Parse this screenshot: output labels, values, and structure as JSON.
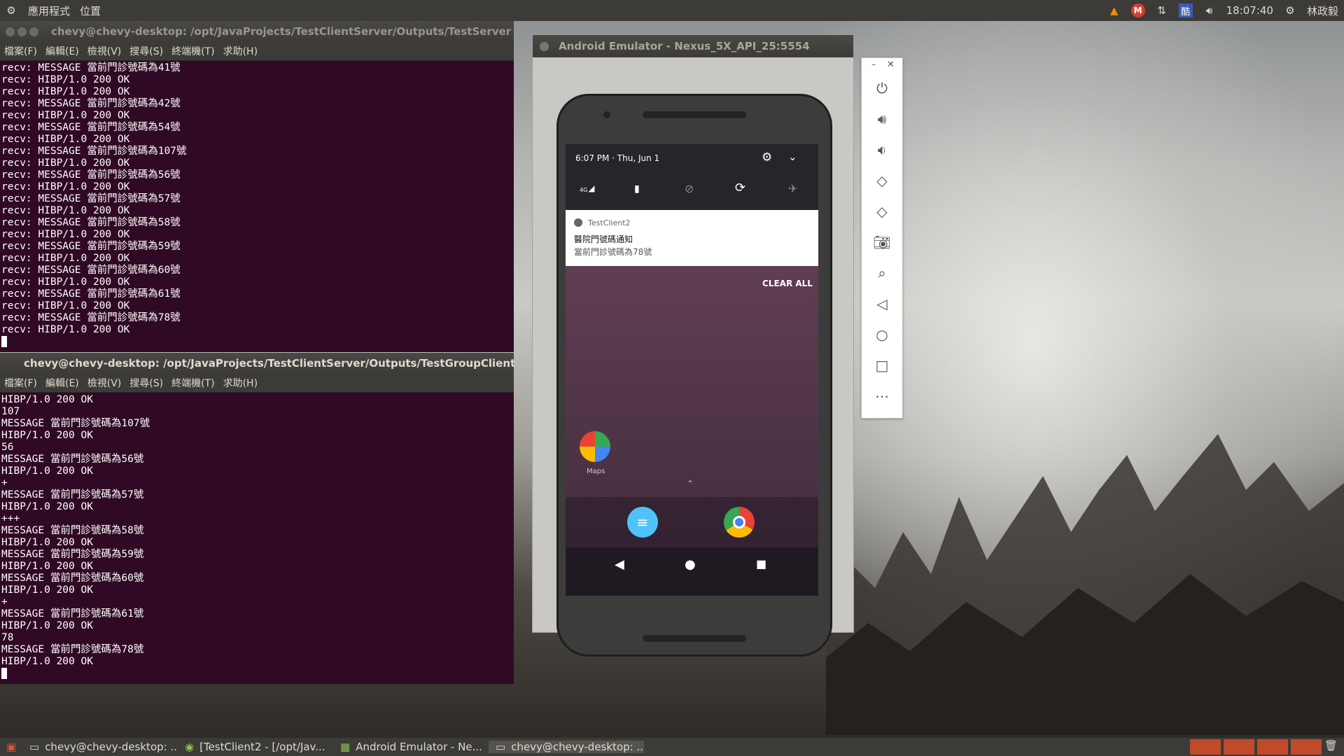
{
  "topbar": {
    "apps_menu": "應用程式",
    "places_menu": "位置",
    "clock": "18:07:40",
    "user": "林政毅",
    "ime_label": "酷"
  },
  "server_term": {
    "title": "chevy@chevy-desktop: /opt/JavaProjects/TestClientServer/Outputs/TestServer",
    "menu": [
      "檔案(F)",
      "編輯(E)",
      "檢視(V)",
      "搜尋(S)",
      "終端機(T)",
      "求助(H)"
    ],
    "lines": [
      "recv: MESSAGE 當前門診號碼為41號",
      "recv: HIBP/1.0 200 OK",
      "recv: HIBP/1.0 200 OK",
      "recv: MESSAGE 當前門診號碼為42號",
      "recv: HIBP/1.0 200 OK",
      "recv: MESSAGE 當前門診號碼為54號",
      "recv: HIBP/1.0 200 OK",
      "recv: MESSAGE 當前門診號碼為107號",
      "recv: HIBP/1.0 200 OK",
      "recv: MESSAGE 當前門診號碼為56號",
      "recv: HIBP/1.0 200 OK",
      "recv: MESSAGE 當前門診號碼為57號",
      "recv: HIBP/1.0 200 OK",
      "recv: MESSAGE 當前門診號碼為58號",
      "recv: HIBP/1.0 200 OK",
      "recv: MESSAGE 當前門診號碼為59號",
      "recv: HIBP/1.0 200 OK",
      "recv: MESSAGE 當前門診號碼為60號",
      "recv: HIBP/1.0 200 OK",
      "recv: MESSAGE 當前門診號碼為61號",
      "recv: HIBP/1.0 200 OK",
      "recv: MESSAGE 當前門診號碼為78號",
      "recv: HIBP/1.0 200 OK"
    ]
  },
  "client_term": {
    "title": "chevy@chevy-desktop: /opt/JavaProjects/TestClientServer/Outputs/TestGroupClient",
    "menu": [
      "檔案(F)",
      "編輯(E)",
      "檢視(V)",
      "搜尋(S)",
      "終端機(T)",
      "求助(H)"
    ],
    "lines": [
      "HIBP/1.0 200 OK",
      "107",
      "MESSAGE 當前門診號碼為107號",
      "HIBP/1.0 200 OK",
      "56",
      "MESSAGE 當前門診號碼為56號",
      "HIBP/1.0 200 OK",
      "+",
      "MESSAGE 當前門診號碼為57號",
      "HIBP/1.0 200 OK",
      "+++",
      "MESSAGE 當前門診號碼為58號",
      "HIBP/1.0 200 OK",
      "MESSAGE 當前門診號碼為59號",
      "HIBP/1.0 200 OK",
      "MESSAGE 當前門診號碼為60號",
      "HIBP/1.0 200 OK",
      "+",
      "MESSAGE 當前門診號碼為61號",
      "HIBP/1.0 200 OK",
      "78",
      "MESSAGE 當前門診號碼為78號",
      "HIBP/1.0 200 OK"
    ]
  },
  "emulator": {
    "title": "Android Emulator - Nexus_5X_API_25:5554",
    "status_time": "6:07 PM · Thu, Jun 1",
    "network_label": "4G",
    "notification": {
      "app": "TestClient2",
      "title": "醫院門號碼通知",
      "text": "當前門診號碼為78號"
    },
    "clear_all": "CLEAR ALL",
    "maps_label": "Maps"
  },
  "taskbar": {
    "tasks": [
      {
        "label": "chevy@chevy-desktop: ...",
        "icon": "terminal-icon"
      },
      {
        "label": "[TestClient2 - [/opt/Jav...",
        "icon": "android-studio-icon"
      },
      {
        "label": "Android Emulator - Ne...",
        "icon": "emulator-icon"
      },
      {
        "label": "chevy@chevy-desktop: ...",
        "icon": "terminal-icon"
      }
    ]
  },
  "colors": {
    "terminal_bg": "#300a24",
    "panel_bg": "#3c3b37",
    "close_btn": "#e2522c"
  }
}
